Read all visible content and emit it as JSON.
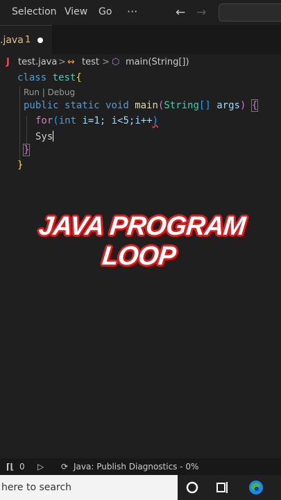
{
  "menubar": {
    "items": [
      "Selection",
      "View",
      "Go",
      "···"
    ],
    "back_icon": "arrow-left-icon",
    "forward_icon": "arrow-right-icon"
  },
  "tab": {
    "name": ".java",
    "problems": "1"
  },
  "breadcrumb": {
    "file": "test.java",
    "sep1": ">",
    "class": "test",
    "sep2": ">",
    "method": "main(String[])"
  },
  "code": {
    "l1_kw": "class",
    "l1_name": "test",
    "l1_brace": "{",
    "codelens": "Run | Debug",
    "l2_kw1": "public",
    "l2_kw2": "static",
    "l2_kw3": "void",
    "l2_fn": "main",
    "l2_p1": "(",
    "l2_type": "String",
    "l2_arr": "[]",
    "l2_arg": "args",
    "l2_p2": ")",
    "l2_brace": "{",
    "l3_for": "for",
    "l3_p1": "(",
    "l3_int": "int",
    "l3_rest": "i=1; i<5;i++",
    "l3_p2": ")",
    "l4": "Sys",
    "l5": "}",
    "l6": "}"
  },
  "overlay": {
    "title": "JAVA PROGRAM LOOP"
  },
  "statusbar": {
    "ports": "0",
    "diagnostics": "Java: Publish Diagnostics - 0%"
  },
  "taskbar": {
    "search_placeholder": "here to search"
  },
  "colors": {
    "keyword": "#569cd6",
    "name": "#4ec9b0",
    "function": "#dcdcaa",
    "param": "#9cdcfe",
    "brace": "#ffd700",
    "control": "#c586c0",
    "bracket2": "#da70d6",
    "bracket3": "#179fff"
  }
}
